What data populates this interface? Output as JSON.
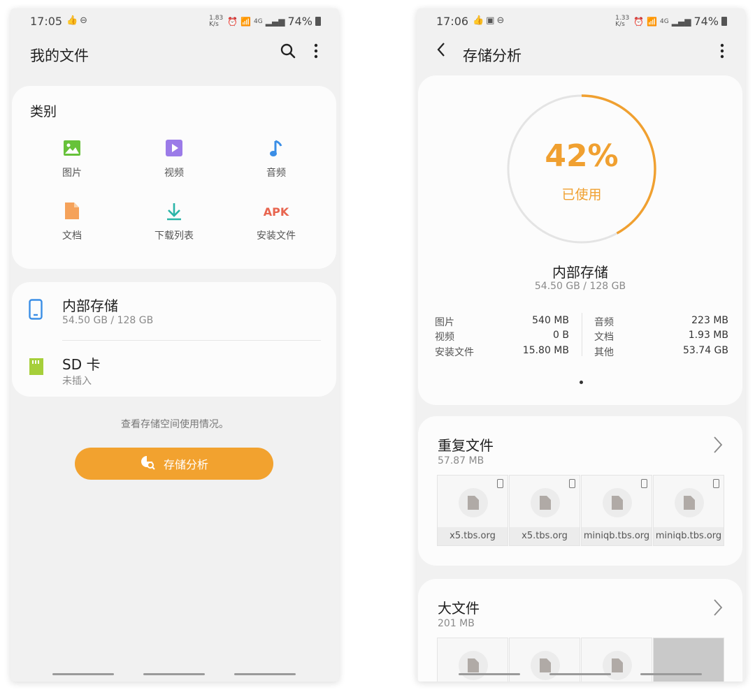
{
  "left": {
    "status": {
      "time": "17:05",
      "net_speed": "1.83 K/s",
      "network": "4G",
      "battery": "74%"
    },
    "app_title": "我的文件",
    "categories": {
      "title": "类别",
      "items": [
        {
          "label": "图片",
          "icon": "image-icon",
          "color": "#67c23a"
        },
        {
          "label": "视频",
          "icon": "video-icon",
          "color": "#9b7be8"
        },
        {
          "label": "音频",
          "icon": "music-icon",
          "color": "#3a8ee6"
        },
        {
          "label": "文档",
          "icon": "document-icon",
          "color": "#f5a25a"
        },
        {
          "label": "下载列表",
          "icon": "download-icon",
          "color": "#2bb5a8"
        },
        {
          "label": "安装文件",
          "icon": "apk-icon",
          "apk_text": "APK",
          "color": "#e8654f"
        }
      ]
    },
    "storage": [
      {
        "name": "内部存储",
        "sub": "54.50 GB / 128 GB",
        "icon": "phone-storage-icon"
      },
      {
        "name": "SD 卡",
        "sub": "未插入",
        "icon": "sd-card-icon"
      }
    ],
    "hint": "查看存储空间使用情况。",
    "analyze_button": "存储分析"
  },
  "right": {
    "status": {
      "time": "17:06",
      "net_speed": "1.33 K/s",
      "network": "4G",
      "battery": "74%"
    },
    "app_title": "存储分析",
    "usage": {
      "percent": 42,
      "percent_label": "42%",
      "used_label": "已使用",
      "color": "#f0a030"
    },
    "internal": {
      "name": "内部存储",
      "sub": "54.50 GB / 128 GB"
    },
    "stats_left": [
      {
        "label": "图片",
        "value": "540 MB"
      },
      {
        "label": "视频",
        "value": "0 B"
      },
      {
        "label": "安装文件",
        "value": "15.80 MB"
      }
    ],
    "stats_right": [
      {
        "label": "音频",
        "value": "223 MB"
      },
      {
        "label": "文档",
        "value": "1.93 MB"
      },
      {
        "label": "其他",
        "value": "53.74 GB"
      }
    ],
    "duplicates": {
      "title": "重复文件",
      "size": "57.87 MB",
      "files": [
        "x5.tbs.org",
        "x5.tbs.org",
        "miniqb.tbs.org",
        "miniqb.tbs.org"
      ]
    },
    "large_files": {
      "title": "大文件",
      "size": "201 MB"
    }
  }
}
